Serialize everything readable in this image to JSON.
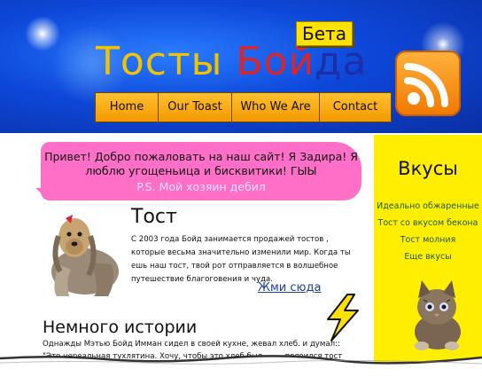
{
  "header": {
    "title_parts": [
      "Тосты",
      "Бойда"
    ],
    "beta_label": "Бета"
  },
  "nav": [
    {
      "label": "Home"
    },
    {
      "label": "Our Toast"
    },
    {
      "label": "Who We Are"
    },
    {
      "label": "Contact"
    }
  ],
  "bubble": {
    "text": "Привет! Добро пожаловать на наш сайт! Я Задира! Я люблю угощеньица и бисквитики! ГЫЫ",
    "ps": "P.S.  Мой хозяин дебил"
  },
  "toast": {
    "heading": "Тост",
    "body": "С 2003 года Бойд занимается продажей тостов , которые весьма значительно изменили мир. Когда ты ешь наш тост, твой рот отправляется в волшебное путешествие благоговения и чуда.",
    "link": "Жми сюда"
  },
  "history": {
    "heading": "Немного истории",
    "body": "Однажды Мэтью Бойд Имман сидел в своей кухне,  жевал хлеб. и думал:: \"Это нереальная тухлятина. Хочу, чтобы это хлеб был … … появился тост Бойда,"
  },
  "sidebar": {
    "title": "Вкусы",
    "links": [
      "Идеально обжаренные",
      "Тост со вкусом бекона",
      "Тост молния",
      "Еще вкусы"
    ]
  },
  "colors": {
    "header_blue": "#0d47d9",
    "nav_orange": "#f49a00",
    "bubble_pink": "#ff6ec7",
    "sidebar_yellow": "#ffee00",
    "link_blue": "#1d3d9e"
  },
  "icons": [
    "rss-icon",
    "dog-image",
    "kitten-image",
    "lightning-bolt-icon"
  ]
}
